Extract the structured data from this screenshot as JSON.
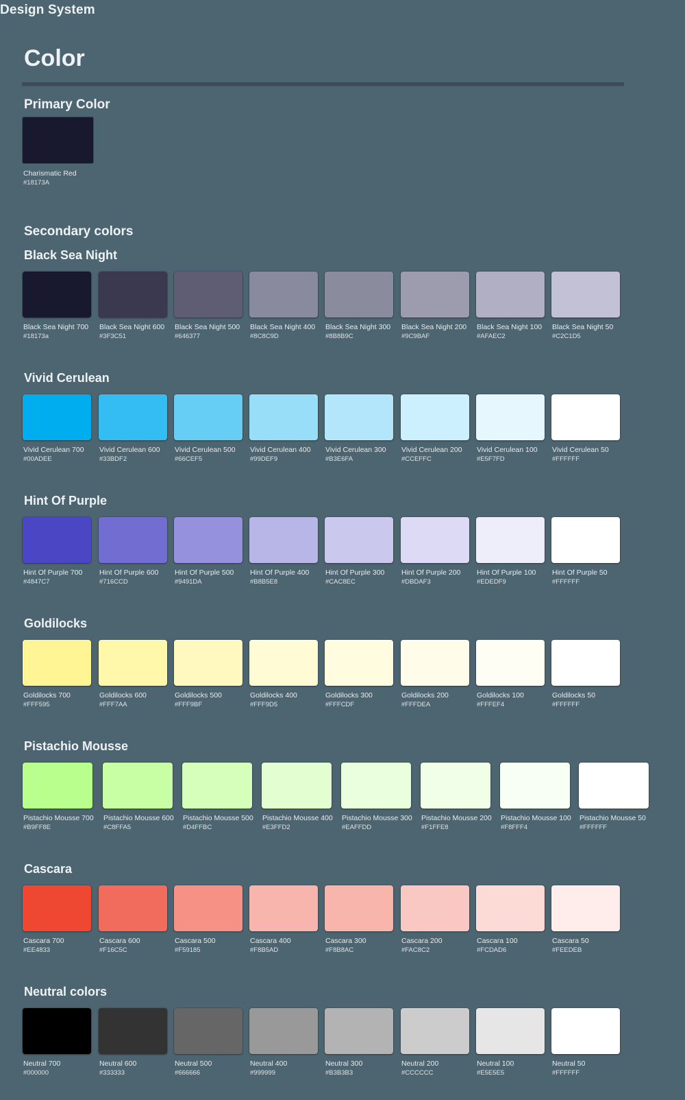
{
  "app_title": "Design System",
  "page_title": "Color",
  "primary": {
    "heading": "Primary Color",
    "name": "Charismatic Red",
    "hex": "#18173A",
    "color": "#18182e"
  },
  "secondary_heading": "Secondary colors",
  "palettes": [
    {
      "title": "Black Sea Night",
      "swatches": [
        {
          "name": "Black Sea Night 700",
          "hex": "#18173a",
          "color": "#18182e"
        },
        {
          "name": "Black Sea Night 600",
          "hex": "#3F3C51",
          "color": "#3a3950"
        },
        {
          "name": "Black Sea Night 500",
          "hex": "#646377",
          "color": "#5e5d73"
        },
        {
          "name": "Black Sea Night 400",
          "hex": "#8C8C9D",
          "color": "#8a8a9e"
        },
        {
          "name": "Black Sea Night 300",
          "hex": "#8B8B9C",
          "color": "#8b8b9e"
        },
        {
          "name": "Black Sea Night 200",
          "hex": "#9C9BAF",
          "color": "#9d9caf"
        },
        {
          "name": "Black Sea Night 100",
          "hex": "#AFAEC2",
          "color": "#b0afc3"
        },
        {
          "name": "Black Sea Night 50",
          "hex": "#C2C1D5",
          "color": "#c2c1d5"
        }
      ]
    },
    {
      "title": "Vivid Cerulean",
      "swatches": [
        {
          "name": "Vivid Cerulean 700",
          "hex": "#00ADEE",
          "color": "#00adef"
        },
        {
          "name": "Vivid Cerulean 600",
          "hex": "#33BDF2",
          "color": "#33bdf2"
        },
        {
          "name": "Vivid Cerulean 500",
          "hex": "#66CEF5",
          "color": "#66cef5"
        },
        {
          "name": "Vivid Cerulean 400",
          "hex": "#99DEF9",
          "color": "#99def9"
        },
        {
          "name": "Vivid Cerulean 300",
          "hex": "#B3E6FA",
          "color": "#b3e6fa"
        },
        {
          "name": "Vivid Cerulean 200",
          "hex": "#CCEFFC",
          "color": "#ccf0fd"
        },
        {
          "name": "Vivid Cerulean 100",
          "hex": "#E5F7FD",
          "color": "#e6f7fe"
        },
        {
          "name": "Vivid Cerulean 50",
          "hex": "#FFFFFF",
          "color": "#ffffff"
        }
      ]
    },
    {
      "title": "Hint Of Purple",
      "swatches": [
        {
          "name": "Hint Of Purple 700",
          "hex": "#4847C7",
          "color": "#4b47c4"
        },
        {
          "name": "Hint Of Purple 600",
          "hex": "#716CCD",
          "color": "#726dd0"
        },
        {
          "name": "Hint Of Purple 500",
          "hex": "#9491DA",
          "color": "#9591dc"
        },
        {
          "name": "Hint Of Purple 400",
          "hex": "#B8B5E8",
          "color": "#b8b5e7"
        },
        {
          "name": "Hint Of Purple 300",
          "hex": "#CAC8EC",
          "color": "#cbc8ee"
        },
        {
          "name": "Hint Of Purple 200",
          "hex": "#DBDAF3",
          "color": "#dcdaf5"
        },
        {
          "name": "Hint Of Purple 100",
          "hex": "#EDEDF9",
          "color": "#eeedfa"
        },
        {
          "name": "Hint Of Purple 50",
          "hex": "#FFFFFF",
          "color": "#ffffff"
        }
      ]
    },
    {
      "title": "Goldilocks",
      "swatches": [
        {
          "name": "Goldilocks 700",
          "hex": "#FFF595",
          "color": "#fff595"
        },
        {
          "name": "Goldilocks 600",
          "hex": "#FFF7AA",
          "color": "#fff7aa"
        },
        {
          "name": "Goldilocks 500",
          "hex": "#FFF9BF",
          "color": "#fff9bf"
        },
        {
          "name": "Goldilocks 400",
          "hex": "#FFF9D5",
          "color": "#fffbd5"
        },
        {
          "name": "Goldilocks 300",
          "hex": "#FFFCDF",
          "color": "#fffcdf"
        },
        {
          "name": "Goldilocks 200",
          "hex": "#FFFDEA",
          "color": "#fffdea"
        },
        {
          "name": "Goldilocks 100",
          "hex": "#FFFEF4",
          "color": "#fffef4"
        },
        {
          "name": "Goldilocks 50",
          "hex": "#FFFFFF",
          "color": "#ffffff"
        }
      ]
    },
    {
      "title": "Pistachio Mousse",
      "swatches": [
        {
          "name": "Pistachio Mousse 700",
          "hex": "#B9FF8E",
          "color": "#b9ff8e"
        },
        {
          "name": "Pistachio Mousse 600",
          "hex": "#C8FFA5",
          "color": "#c8ffa5"
        },
        {
          "name": "Pistachio Mousse 500",
          "hex": "#D4FFBC",
          "color": "#d5ffbb"
        },
        {
          "name": "Pistachio Mousse 400",
          "hex": "#E3FFD2",
          "color": "#e3ffd2"
        },
        {
          "name": "Pistachio Mousse 300",
          "hex": "#EAFFDD",
          "color": "#eaffdd"
        },
        {
          "name": "Pistachio Mousse 200",
          "hex": "#F1FFE8",
          "color": "#f1ffe8"
        },
        {
          "name": "Pistachio Mousse 100",
          "hex": "#F8FFF4",
          "color": "#f8fff4"
        },
        {
          "name": "Pistachio Mousse 50",
          "hex": "#FFFFFF",
          "color": "#ffffff"
        }
      ]
    },
    {
      "title": "Cascara",
      "swatches": [
        {
          "name": "Cascara 700",
          "hex": "#EE4833",
          "color": "#ee4833"
        },
        {
          "name": "Cascara 600",
          "hex": "#F16C5C",
          "color": "#f16c5c"
        },
        {
          "name": "Cascara 500",
          "hex": "#F59185",
          "color": "#f59185"
        },
        {
          "name": "Cascara 400",
          "hex": "#F8B5AD",
          "color": "#f8b5ad"
        },
        {
          "name": "Cascara 300",
          "hex": "#F8B8AC",
          "color": "#f8b5ac"
        },
        {
          "name": "Cascara 200",
          "hex": "#FAC8C2",
          "color": "#fac8c2"
        },
        {
          "name": "Cascara 100",
          "hex": "#FCDAD6",
          "color": "#fcdad6"
        },
        {
          "name": "Cascara 50",
          "hex": "#FEEDEB",
          "color": "#feedeb"
        }
      ]
    },
    {
      "title": "Neutral colors",
      "swatches": [
        {
          "name": "Neutral 700",
          "hex": "#000000",
          "color": "#000000"
        },
        {
          "name": "Neutral 600",
          "hex": "#333333",
          "color": "#333333"
        },
        {
          "name": "Neutral 500",
          "hex": "#666666",
          "color": "#666666"
        },
        {
          "name": "Neutral 400",
          "hex": "#999999",
          "color": "#999999"
        },
        {
          "name": "Neutral 300",
          "hex": "#B3B3B3",
          "color": "#b3b3b3"
        },
        {
          "name": "Neutral 200",
          "hex": "#CCCCCC",
          "color": "#cccccc"
        },
        {
          "name": "Neutral 100",
          "hex": "#E5E5E5",
          "color": "#e6e6e6"
        },
        {
          "name": "Neutral 50",
          "hex": "#FFFFFF",
          "color": "#ffffff"
        }
      ]
    }
  ]
}
